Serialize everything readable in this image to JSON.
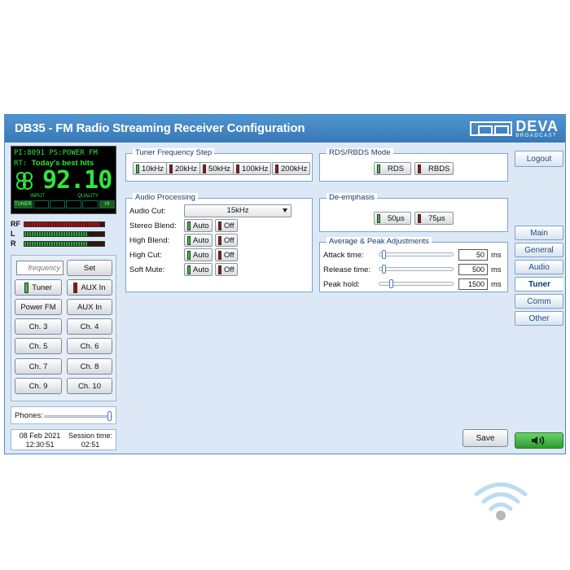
{
  "app": {
    "title": "DB35 - FM Radio Streaming Receiver Configuration",
    "logo": "DEVA",
    "logo_sub": "BROADCAST"
  },
  "display": {
    "line1": "PI:8091 PS:POWER FM",
    "rt_label": "RT:",
    "rt_text": "Today's best hits",
    "frequency": "92.10",
    "input_label": "INPUT",
    "quality_label": "QUALITY",
    "sources": [
      "TUNER",
      "",
      "",
      "",
      "",
      "HI"
    ]
  },
  "meters": [
    {
      "label": "RF",
      "level": 0.95
    },
    {
      "label": "L",
      "level": 0.8
    },
    {
      "label": "R",
      "level": 0.8
    }
  ],
  "controls": {
    "frequency_placeholder": "frequency",
    "set_label": "Set",
    "tuner_label": "Tuner",
    "aux_label": "AUX In",
    "power_fm_label": "Power FM",
    "aux_in2_label": "AUX In",
    "channels": [
      "Ch. 3",
      "Ch. 4",
      "Ch. 5",
      "Ch. 6",
      "Ch. 7",
      "Ch. 8",
      "Ch. 9",
      "Ch. 10"
    ]
  },
  "phones": {
    "label": "Phones:",
    "level": 1.0
  },
  "time": {
    "date": "08 Feb 2021",
    "clock": "12:30:51",
    "session_label": "Session time:",
    "session": "02:51"
  },
  "tuner_step": {
    "title": "Tuner Frequency Step",
    "options": [
      "10kHz",
      "20kHz",
      "50kHz",
      "100kHz",
      "200kHz"
    ],
    "selected": "10kHz"
  },
  "audio_processing": {
    "title": "Audio Processing",
    "audio_cut_label": "Audio Cut:",
    "audio_cut_value": "15kHz",
    "rows": [
      {
        "label": "Stereo Blend:",
        "auto": "Auto",
        "off": "Off"
      },
      {
        "label": "High Blend:",
        "auto": "Auto",
        "off": "Off"
      },
      {
        "label": "High Cut:",
        "auto": "Auto",
        "off": "Off"
      },
      {
        "label": "Soft Mute:",
        "auto": "Auto",
        "off": "Off"
      }
    ]
  },
  "rds_mode": {
    "title": "RDS/RBDS Mode",
    "rds": "RDS",
    "rbds": "RBDS",
    "selected": "RDS"
  },
  "deemphasis": {
    "title": "De-emphasis",
    "opt1": "50µs",
    "opt2": "75µs",
    "selected": "50µs"
  },
  "peak": {
    "title": "Average & Peak Adjustments",
    "rows": [
      {
        "label": "Attack time:",
        "value": "50",
        "unit": "ms",
        "level": 0.05
      },
      {
        "label": "Release time:",
        "value": "500",
        "unit": "ms",
        "level": 0.05
      },
      {
        "label": "Peak hold:",
        "value": "1500",
        "unit": "ms",
        "level": 0.15
      }
    ]
  },
  "save_label": "Save",
  "nav": {
    "logout": "Logout",
    "items": [
      "Main",
      "General",
      "Audio",
      "Tuner",
      "Comm",
      "Other"
    ],
    "active": "Tuner"
  },
  "colors": {
    "accent": "#3c7dbc",
    "led_on": "#40c040",
    "led_off": "#a01010",
    "lcd": "#2fe63a"
  }
}
